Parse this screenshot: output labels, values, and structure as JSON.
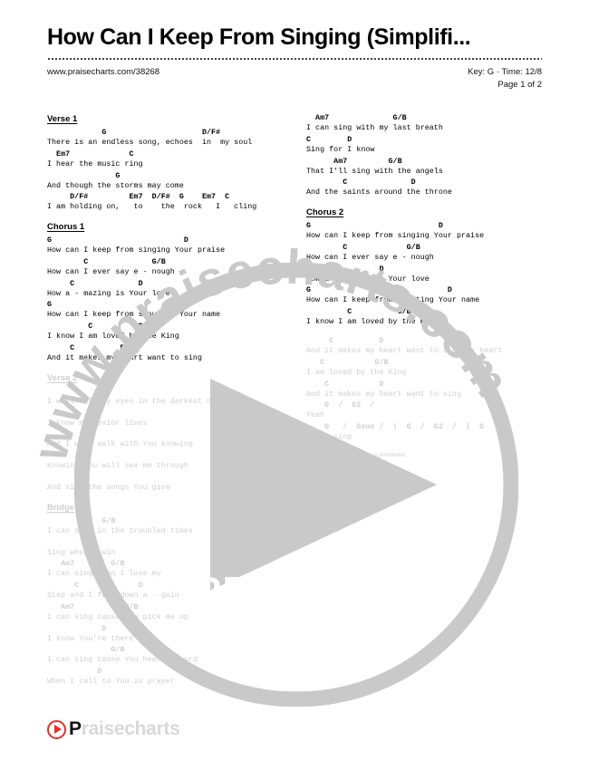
{
  "header": {
    "title": "How Can I Keep From Singing (Simplifi...",
    "url": "www.praisecharts.com/38268",
    "key_time": "Key: G · Time: 12/8",
    "page_indicator": "Page 1 of 2"
  },
  "watermark": {
    "arc_text": "www.praisecharts.com",
    "preview_label": "PREVIEW"
  },
  "footer": {
    "logo_play_icon": "play-circle-icon",
    "logo_text_dark": "P",
    "logo_text_light": "raisecharts",
    "copyright": "Unauthorized distribution is prohibited."
  },
  "left_column": {
    "sections": [
      {
        "heading": "Verse 1",
        "faded": false,
        "lines": [
          {
            "chords": "            G                     D/F#",
            "lyric": "There is an endless song, echoes  in  my soul"
          },
          {
            "chords": "  Em7             C",
            "lyric": "I hear the music ring"
          },
          {
            "chords": "               G",
            "lyric": "And though the storms may come"
          },
          {
            "chords": "     D/F#         Em7  D/F#  G    Em7  C",
            "lyric": "I am holding on,   to    the  rock   I   cling"
          }
        ]
      },
      {
        "heading": "Chorus 1",
        "faded": false,
        "lines": [
          {
            "chords": "G                             D",
            "lyric": "How can I keep from singing Your praise"
          },
          {
            "chords": "        C              G/B",
            "lyric": "How can I ever say e - nough"
          },
          {
            "chords": "     C              D",
            "lyric": "How a - mazing is Your love"
          },
          {
            "chords": "G                              D",
            "lyric": "How can I keep from shouting Your name"
          },
          {
            "chords": "         C          G/B",
            "lyric": "I know I am loved by the King"
          },
          {
            "chords": "     C          D",
            "lyric": "And it makes my heart want to sing"
          }
        ]
      },
      {
        "heading": "Verse 2",
        "faded": true,
        "heading_partial": true,
        "lines": [
          {
            "chords": "",
            "lyric": "I will lift my eyes in the darkest night for"
          },
          {
            "chords": "",
            "lyric": "I know my Savior lives"
          },
          {
            "chords": "",
            "lyric": "And I will walk with You knowing"
          },
          {
            "chords": "",
            "lyric": "Knowing You will see me through"
          },
          {
            "chords": "",
            "lyric": "And sing the songs You give"
          }
        ]
      },
      {
        "heading": "Bridge",
        "faded": true,
        "heading_partial": true,
        "lines": [
          {
            "chords": "            G/B",
            "lyric": "I can sing in the troubled times"
          },
          {
            "chords": "        D",
            "lyric": "Sing when I win"
          },
          {
            "chords": "   Am7        G/B",
            "lyric": "I can sing when I lose my"
          },
          {
            "chords": "      C             D",
            "lyric": "Step and I fall down a - gain"
          },
          {
            "chords": "   Am7           G/B",
            "lyric": "I can sing cause you pick me up"
          },
          {
            "chords": "            D",
            "lyric": "I know You're there"
          },
          {
            "chords": "              G/B",
            "lyric": "I can sing cause You hear me Lord"
          },
          {
            "chords": "           D",
            "lyric": "When I call to You in prayer"
          }
        ]
      }
    ]
  },
  "right_column": {
    "sections": [
      {
        "heading": "",
        "faded": false,
        "lines": [
          {
            "chords": "  Am7              G/B",
            "lyric": "I can sing with my last breath"
          },
          {
            "chords": "C        D",
            "lyric": "Sing for I know"
          },
          {
            "chords": "      Am7         G/B",
            "lyric": "That I'll sing with the angels"
          },
          {
            "chords": "        C              D",
            "lyric": "And the saints around the throne"
          }
        ]
      },
      {
        "heading": "Chorus 2",
        "faded": false,
        "lines": [
          {
            "chords": "G                            D",
            "lyric": "How can I keep from singing Your praise"
          },
          {
            "chords": "        C             G/B",
            "lyric": "How can I ever say e - nough"
          },
          {
            "chords": "     C          D",
            "lyric": "How a - mazing is Your love"
          },
          {
            "chords": "G                              D",
            "lyric": "How can I keep from shouting Your name"
          },
          {
            "chords": "         C          G/B",
            "lyric": "I know I am loved by the King"
          }
        ]
      },
      {
        "heading": "",
        "faded": true,
        "lines": [
          {
            "chords": "     C          D",
            "lyric": "And it makes my heart want to sing my heart"
          },
          {
            "chords": "   C           G/B",
            "lyric": "I am loved by the King"
          },
          {
            "chords": "    C           D",
            "lyric": "And it makes my heart want to sing"
          },
          {
            "chords": "    G  /  G2  /",
            "lyric": "Yeah"
          },
          {
            "chords": "    G   /  Gsus /  |  G  /  G2  /  |  G",
            "lyric": "I can sing"
          }
        ]
      }
    ]
  }
}
